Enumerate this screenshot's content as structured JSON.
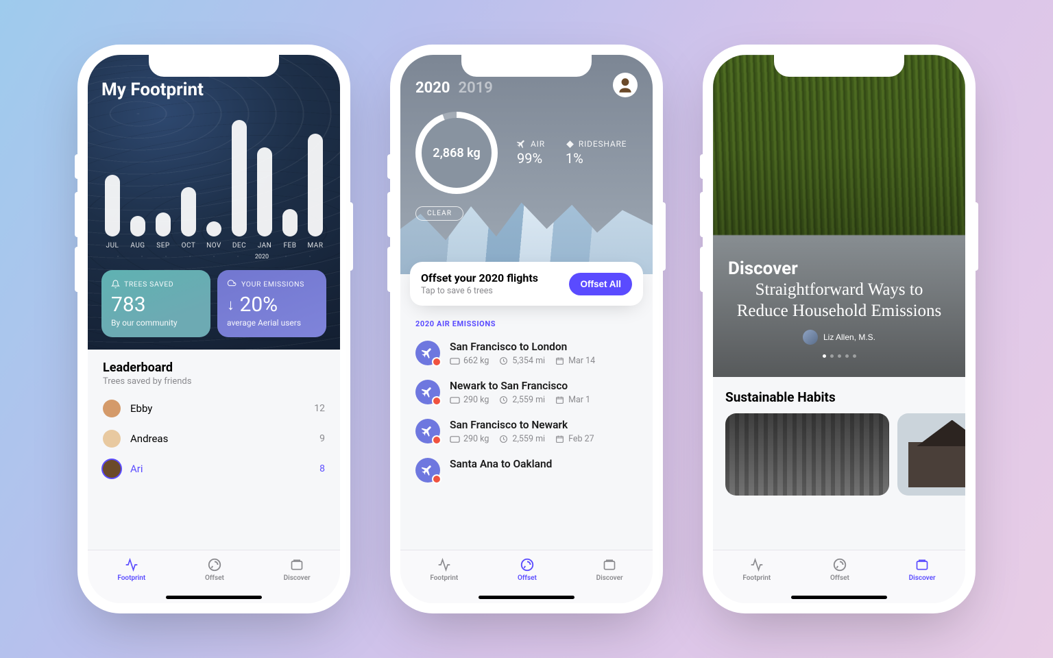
{
  "tabbar": {
    "footprint": "Footprint",
    "offset": "Offset",
    "discover": "Discover"
  },
  "colors": {
    "accent": "#5A4BFF"
  },
  "phone1": {
    "title": "My Footprint",
    "yearLabel": "2020",
    "bars": [
      {
        "label": "JUL",
        "h": 90
      },
      {
        "label": "AUG",
        "h": 30
      },
      {
        "label": "SEP",
        "h": 35
      },
      {
        "label": "OCT",
        "h": 72
      },
      {
        "label": "NOV",
        "h": 22
      },
      {
        "label": "DEC",
        "h": 170
      },
      {
        "label": "JAN",
        "h": 130
      },
      {
        "label": "FEB",
        "h": 40
      },
      {
        "label": "MAR",
        "h": 150
      }
    ],
    "cardTrees": {
      "label": "TREES SAVED",
      "value": "783",
      "sub": "By our community"
    },
    "cardEmissions": {
      "label": "YOUR EMISSIONS",
      "value": "20%",
      "sub": "average Aerial users",
      "arrow": "down"
    },
    "leaderboard": {
      "title": "Leaderboard",
      "sub": "Trees saved by friends",
      "rows": [
        {
          "name": "Ebby",
          "count": "12",
          "avatar": "#d49a6a"
        },
        {
          "name": "Andreas",
          "count": "9",
          "avatar": "#e8c9a0"
        },
        {
          "name": "Ari",
          "count": "8",
          "avatar": "#6b4a2a",
          "active": true
        }
      ]
    }
  },
  "phone2": {
    "years": {
      "active": "2020",
      "other": "2019"
    },
    "ringValue": "2,868 kg",
    "breakdown": [
      {
        "label": "AIR",
        "pct": "99%",
        "icon": "plane"
      },
      {
        "label": "RIDESHARE",
        "pct": "1%",
        "icon": "diamond"
      }
    ],
    "clear": "CLEAR",
    "offsetCard": {
      "title": "Offset your 2020 flights",
      "sub": "Tap to save 6 trees",
      "button": "Offset All"
    },
    "sectionLabel": "2020 AIR EMISSIONS",
    "flights": [
      {
        "route": "San Francisco to London",
        "co2": "662 kg",
        "dist": "5,354 mi",
        "date": "Mar 14"
      },
      {
        "route": "Newark to San Francisco",
        "co2": "290 kg",
        "dist": "2,559 mi",
        "date": "Mar 1"
      },
      {
        "route": "San Francisco to Newark",
        "co2": "290 kg",
        "dist": "2,559 mi",
        "date": "Feb 27"
      },
      {
        "route": "Santa Ana to Oakland",
        "co2": "",
        "dist": "",
        "date": ""
      }
    ]
  },
  "phone3": {
    "title": "Discover",
    "article": {
      "headline": "Straightforward Ways to Reduce Household Emissions",
      "author": "Liz Allen, M.S."
    },
    "habitsTitle": "Sustainable Habits"
  },
  "chart_data": {
    "type": "bar",
    "categories": [
      "JUL",
      "AUG",
      "SEP",
      "OCT",
      "NOV",
      "DEC",
      "JAN",
      "FEB",
      "MAR"
    ],
    "values": [
      90,
      30,
      35,
      72,
      22,
      170,
      130,
      40,
      150
    ],
    "title": "My Footprint",
    "xlabel": "",
    "ylabel": "",
    "ylim": [
      0,
      180
    ],
    "note": "values are relative bar pixel heights; no y-axis scale shown in source"
  }
}
